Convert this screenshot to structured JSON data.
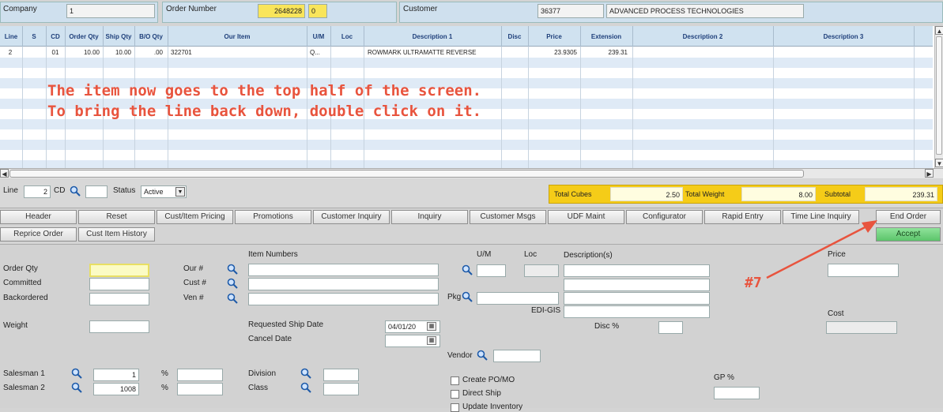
{
  "header": {
    "company_label": "Company",
    "company_value": "1",
    "order_label": "Order Number",
    "order_value": "2648228",
    "order_suffix": "0",
    "customer_label": "Customer",
    "customer_id": "36377",
    "customer_name": "ADVANCED PROCESS TECHNOLOGIES"
  },
  "grid": {
    "columns": [
      "Line",
      "S",
      "CD",
      "Order Qty",
      "Ship Qty",
      "B/O Qty",
      "Our Item",
      "U/M",
      "Loc",
      "Description 1",
      "Disc",
      "Price",
      "Extension",
      "Description 2",
      "Description 3"
    ],
    "rows": [
      {
        "line": "2",
        "s": "",
        "cd": "01",
        "order_qty": "10.00",
        "ship_qty": "10.00",
        "bo_qty": ".00",
        "our_item": "322701",
        "um": "Q...",
        "loc": "",
        "desc1": "ROWMARK ULTRAMATTE REVERSE",
        "disc": "",
        "price": "23.9305",
        "extension": "239.31",
        "desc2": "",
        "desc3": ""
      }
    ]
  },
  "overlay": {
    "line1": "The item now goes to the top half of the screen.",
    "line2": "To bring the line back down, double click on it.",
    "marker": "#7"
  },
  "line_bar": {
    "line_label": "Line",
    "line_value": "2",
    "cd_label": "CD",
    "cd_value": "",
    "status_label": "Status",
    "status_value": "Active"
  },
  "totals": {
    "cubes_label": "Total Cubes",
    "cubes_value": "2.50",
    "weight_label": "Total Weight",
    "weight_value": "8.00",
    "subtotal_label": "Subtotal",
    "subtotal_value": "239.31"
  },
  "buttons_row1": [
    "Header",
    "Reset",
    "Cust/Item Pricing",
    "Promotions",
    "Customer Inquiry",
    "Inquiry",
    "Customer Msgs",
    "UDF Maint",
    "Configurator",
    "Rapid Entry",
    "Time Line Inquiry",
    "End Order"
  ],
  "buttons_row2": [
    "Reprice Order",
    "Cust Item History"
  ],
  "accept_label": "Accept",
  "form": {
    "order_qty_label": "Order Qty",
    "committed_label": "Committed",
    "backordered_label": "Backordered",
    "weight_label": "Weight",
    "salesman1_label": "Salesman 1",
    "salesman1_value": "1",
    "salesman2_label": "Salesman 2",
    "salesman2_value": "1008",
    "pct": "%",
    "item_numbers_label": "Item Numbers",
    "our_no_label": "Our #",
    "cust_no_label": "Cust #",
    "ven_no_label": "Ven #",
    "req_ship_label": "Requested Ship Date",
    "req_ship_value": "04/01/20",
    "cancel_label": "Cancel Date",
    "division_label": "Division",
    "class_label": "Class",
    "um_label": "U/M",
    "loc_label": "Loc",
    "descs_label": "Description(s)",
    "pkg_label": "Pkg",
    "edigis_label": "EDI-GIS",
    "disc_pct_label": "Disc %",
    "vendor_label": "Vendor",
    "create_po_label": "Create PO/MO",
    "direct_ship_label": "Direct Ship",
    "update_inv_label": "Update Inventory",
    "price_label": "Price",
    "cost_label": "Cost",
    "gp_label": "GP %"
  },
  "colors": {
    "annotation": "#e8543e",
    "header_bg": "#cfe0ee",
    "highlight_yellow": "#f9e55a",
    "accept_green": "#5cc46a"
  }
}
